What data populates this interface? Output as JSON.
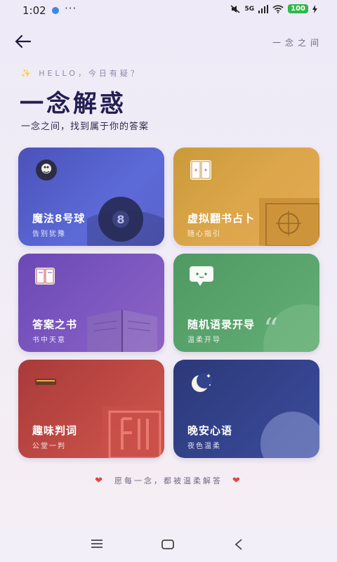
{
  "status": {
    "time": "1:02",
    "dots": "···",
    "network": "5G",
    "battery": "100"
  },
  "header": {
    "brand": "一念之间"
  },
  "hero": {
    "hello": "✨ HELLO，今日有疑？",
    "title": "一念解惑",
    "subtitle": "一念之间，找到属于你的答案"
  },
  "cards": [
    {
      "title": "魔法8号球",
      "subtitle": "告别犹豫",
      "icon": "magic-ball-icon",
      "color": "#5560c8"
    },
    {
      "title": "虚拟翻书占卜",
      "subtitle": "随心指引",
      "icon": "book-icon",
      "color": "#d9a248"
    },
    {
      "title": "答案之书",
      "subtitle": "书中天意",
      "icon": "open-book-icon",
      "color": "#7a56bf"
    },
    {
      "title": "随机语录开导",
      "subtitle": "温柔开导",
      "icon": "chat-bubble-icon",
      "color": "#59a36b"
    },
    {
      "title": "趣味判词",
      "subtitle": "公堂一判",
      "icon": "gavel-icon",
      "color": "#bd4842"
    },
    {
      "title": "晚安心语",
      "subtitle": "夜色温柔",
      "icon": "moon-icon",
      "color": "#34428c"
    }
  ],
  "footer": {
    "text": "愿每一念，都被温柔解答"
  }
}
